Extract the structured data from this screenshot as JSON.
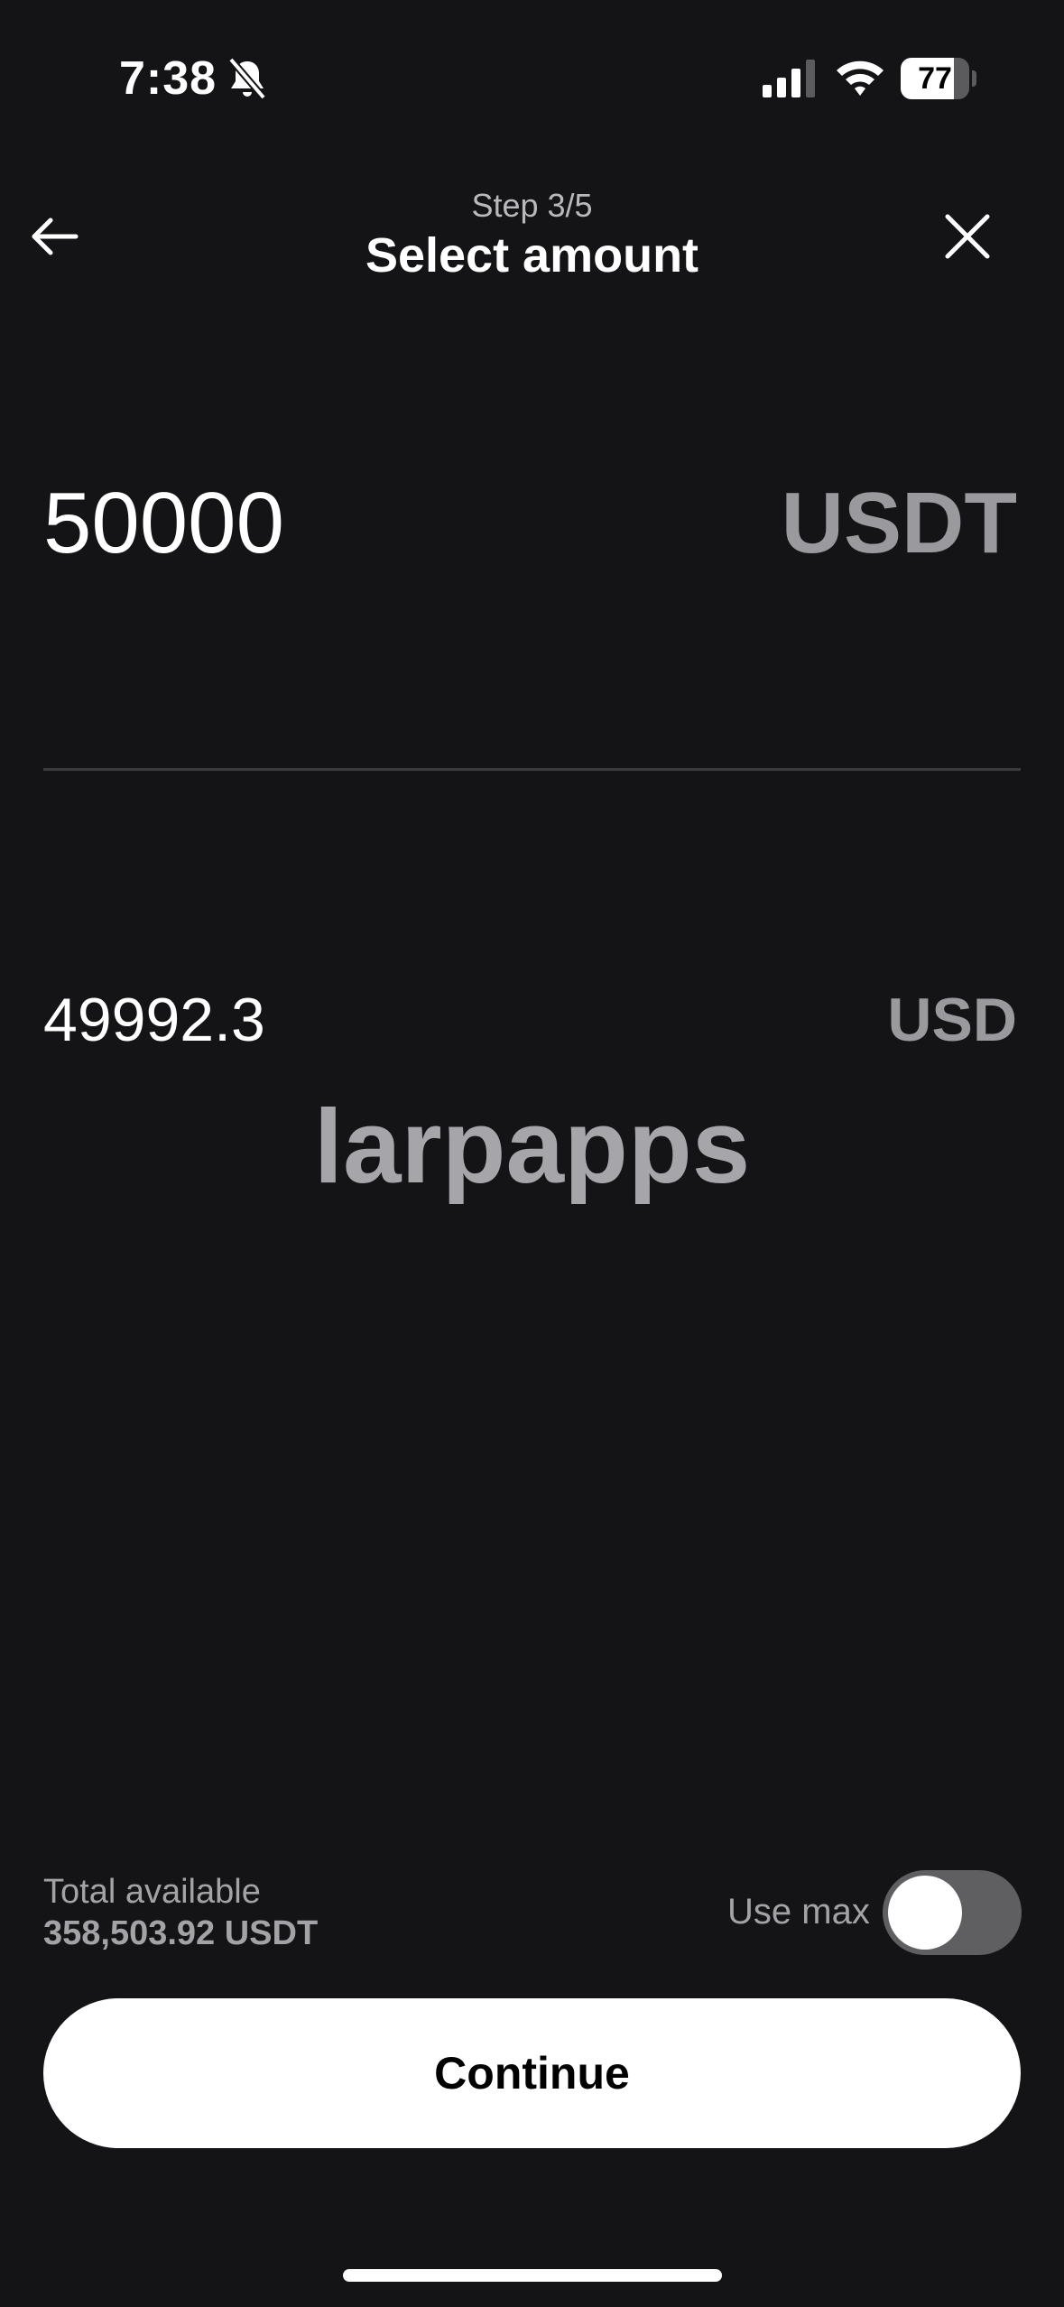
{
  "status_bar": {
    "time": "7:38",
    "battery_level": "77",
    "battery_fraction": 0.77
  },
  "header": {
    "step": "Step 3/5",
    "title": "Select amount"
  },
  "amount": {
    "value": "50000",
    "currency": "USDT",
    "converted_value": "49992.3",
    "converted_currency": "USD"
  },
  "watermark": "larpapps",
  "footer": {
    "available_label": "Total available",
    "available_value": "358,503.92 USDT",
    "use_max_label": "Use max",
    "use_max_enabled": false,
    "continue_label": "Continue"
  },
  "colors": {
    "background": "#141416",
    "muted_text": "#a3a3a7",
    "button_bg": "#ffffff",
    "toggle_off": "#5f5f62"
  }
}
